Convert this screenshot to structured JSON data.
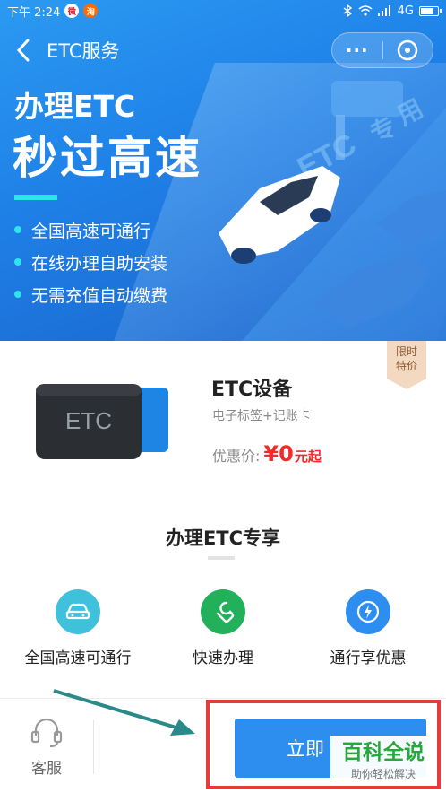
{
  "status_bar": {
    "time": "下午 2:24",
    "network": "4G"
  },
  "nav": {
    "title": "ETC服务",
    "more_label": "···"
  },
  "hero": {
    "subtitle": "办理ETC",
    "title": "秒过高速",
    "features": [
      "全国高速可通行",
      "在线办理自助安装",
      "无需充值自动缴费"
    ],
    "road_text_1": "ETC",
    "road_text_2": "用",
    "road_text_3": "专"
  },
  "product": {
    "tag_line1": "限时",
    "tag_line2": "特价",
    "device_label": "ETC",
    "name": "ETC设备",
    "desc": "电子标签+记账卡",
    "price_label": "优惠价:",
    "price_value": "¥0",
    "price_unit": "元起"
  },
  "benefits": {
    "title": "办理ETC专享",
    "items": [
      {
        "label": "全国高速可通行",
        "icon": "car-icon",
        "color": "#3fc1dc"
      },
      {
        "label": "快速办理",
        "icon": "wrench-icon",
        "color": "#22b05a"
      },
      {
        "label": "通行享优惠",
        "icon": "lightning-icon",
        "color": "#2d8ef0"
      }
    ]
  },
  "bottom_bar": {
    "service_label": "客服",
    "apply_label": "立即"
  },
  "watermark": {
    "big": "百科全说",
    "small": "助你轻松解决"
  },
  "colors": {
    "accent": "#2d8ef0",
    "price": "#f52a2a",
    "highlight": "#e53b3b"
  }
}
